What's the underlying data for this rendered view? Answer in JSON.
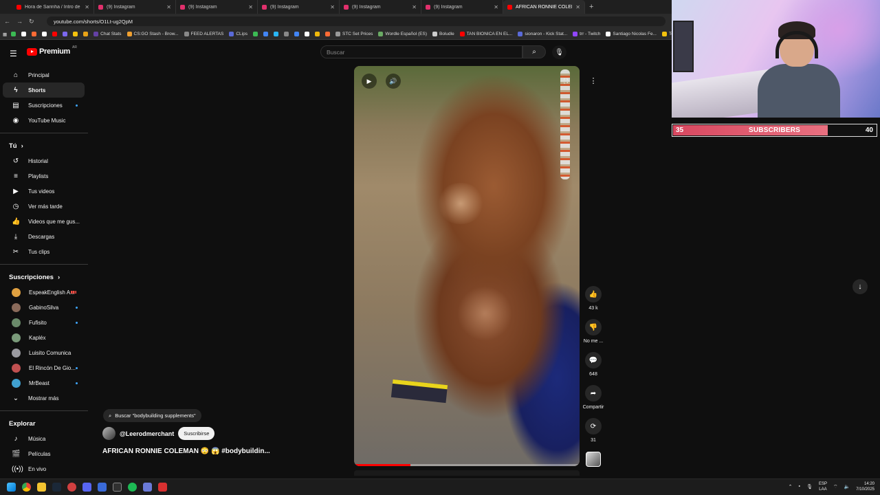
{
  "browser": {
    "tabs": [
      {
        "title": "Hora de Sarinha / Intro de Sarin",
        "fav": "#ff0000"
      },
      {
        "title": "(9) Instagram",
        "fav": "#e1306c"
      },
      {
        "title": "(9) Instagram",
        "fav": "#e1306c"
      },
      {
        "title": "(9) Instagram",
        "fav": "#e1306c"
      },
      {
        "title": "(9) Instagram",
        "fav": "#e1306c"
      },
      {
        "title": "(9) Instagram",
        "fav": "#e1306c"
      },
      {
        "title": "AFRICAN RONNIE COLEMA",
        "fav": "#ff0000",
        "active": true
      }
    ],
    "new_tab": "+",
    "url": "youtube.com/shorts/O1Lt-ug2QpM",
    "bookmarks": [
      {
        "label": "",
        "color": "#3cba54"
      },
      {
        "label": "",
        "color": "#ffffff"
      },
      {
        "label": "",
        "color": "#ff6b35"
      },
      {
        "label": "",
        "color": "#ffffff"
      },
      {
        "label": "",
        "color": "#ff0000"
      },
      {
        "label": "",
        "color": "#7b68ee"
      },
      {
        "label": "",
        "color": "#f4c20d"
      },
      {
        "label": "",
        "color": "#e8a317"
      },
      {
        "label": "Chat Stats",
        "color": "#6441a5"
      },
      {
        "label": "CS:GO Stash - Brow...",
        "color": "#f0a030"
      },
      {
        "label": "FEED ALERTAS",
        "color": "#888888"
      },
      {
        "label": "CLips",
        "color": "#5a6ad8"
      },
      {
        "label": "",
        "color": "#3cba54"
      },
      {
        "label": "",
        "color": "#4285f4"
      },
      {
        "label": "",
        "color": "#29b6f6"
      },
      {
        "label": "",
        "color": "#888888"
      },
      {
        "label": "",
        "color": "#4285f4"
      },
      {
        "label": "",
        "color": "#ffffff"
      },
      {
        "label": "",
        "color": "#f0b90b"
      },
      {
        "label": "",
        "color": "#ff6b35"
      },
      {
        "label": "STC Set Prices",
        "color": "#999999"
      },
      {
        "label": "Wordle Español (ES)",
        "color": "#6aaa64"
      },
      {
        "label": "Boludle",
        "color": "#cccccc"
      },
      {
        "label": "TAN BIONICA EN EL...",
        "color": "#ff0000"
      },
      {
        "label": "sionaron - Kick Stat...",
        "color": "#5a6ad8"
      },
      {
        "label": "trr - Twitch",
        "color": "#9146ff"
      },
      {
        "label": "Santiago Nicolas Fe...",
        "color": "#ffffff"
      },
      {
        "label": "Te",
        "color": "#f4c20d"
      }
    ]
  },
  "youtube": {
    "logo": "Premium",
    "country": "AR",
    "search_placeholder": "Buscar",
    "sidebar": {
      "main": [
        {
          "label": "Principal",
          "icon": "home-icon",
          "glyph": "⌂"
        },
        {
          "label": "Shorts",
          "icon": "shorts-icon",
          "glyph": "ϟ",
          "active": true
        },
        {
          "label": "Suscripciones",
          "icon": "subscriptions-icon",
          "glyph": "▤",
          "dot": true
        },
        {
          "label": "YouTube Music",
          "icon": "youtube-music-icon",
          "glyph": "◉"
        }
      ],
      "you_heading": "Tú",
      "you": [
        {
          "label": "Historial",
          "icon": "history-icon",
          "glyph": "↺"
        },
        {
          "label": "Playlists",
          "icon": "playlists-icon",
          "glyph": "≡"
        },
        {
          "label": "Tus videos",
          "icon": "your-videos-icon",
          "glyph": "▶"
        },
        {
          "label": "Ver más tarde",
          "icon": "watch-later-icon",
          "glyph": "◷"
        },
        {
          "label": "Videos que me gus...",
          "icon": "liked-videos-icon",
          "glyph": "👍"
        },
        {
          "label": "Descargas",
          "icon": "downloads-icon",
          "glyph": "⤓"
        },
        {
          "label": "Tus clips",
          "icon": "clips-icon",
          "glyph": "✂"
        }
      ],
      "subs_heading": "Suscripciones",
      "subs": [
        {
          "label": "EspeakEnglish A...",
          "color": "#e0a040",
          "live": true
        },
        {
          "label": "GabinoSilva",
          "color": "#8a6a5a",
          "dot": true
        },
        {
          "label": "Fufisito",
          "color": "#6a8a6a",
          "dot": true
        },
        {
          "label": "Kapléx",
          "color": "#7a9a7a"
        },
        {
          "label": "Luisito Comunica",
          "color": "#9a9aa0"
        },
        {
          "label": "El Rincón De Gio...",
          "color": "#c05050",
          "dot": true
        },
        {
          "label": "MrBeast",
          "color": "#40a0d0",
          "dot": true
        }
      ],
      "show_more": "Mostrar más",
      "explore_heading": "Explorar",
      "explore": [
        {
          "label": "Música",
          "icon": "music-icon",
          "glyph": "♪"
        },
        {
          "label": "Películas",
          "icon": "movies-icon",
          "glyph": "🎬"
        },
        {
          "label": "En vivo",
          "icon": "live-icon",
          "glyph": "((•))"
        },
        {
          "label": "Videojuegos",
          "icon": "gaming-icon",
          "glyph": "🎮"
        }
      ]
    },
    "short": {
      "search_chip": "Buscar \"bodybuilding supplements\"",
      "channel": "@Leerodmerchant",
      "subscribe": "Suscribirse",
      "title": "AFRICAN RONNIE COLEMAN 😳 😱 #bodybuildin...",
      "progress": 0.25,
      "actions": [
        {
          "name": "like",
          "glyph": "👍",
          "label": "43 k"
        },
        {
          "name": "dislike",
          "glyph": "👎",
          "label": "No me ..."
        },
        {
          "name": "comments",
          "glyph": "💬",
          "label": "648"
        },
        {
          "name": "share",
          "glyph": "➦",
          "label": "Compartir"
        },
        {
          "name": "remix",
          "glyph": "⟳",
          "label": "31"
        }
      ]
    }
  },
  "overlay": {
    "sub_current": "35",
    "sub_label": "SUBSCRIBERS",
    "sub_goal": "40",
    "sub_progress": 0.875
  },
  "taskbar": {
    "lang_line1": "ESP",
    "lang_line2": "LAA",
    "time": "14:20",
    "date": "7/10/2025"
  }
}
